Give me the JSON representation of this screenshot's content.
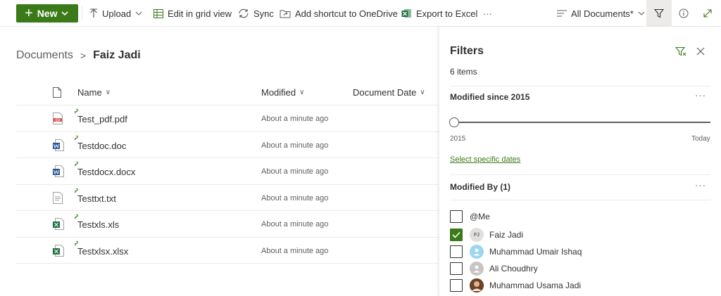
{
  "toolbar": {
    "new_label": "New",
    "upload_label": "Upload",
    "grid_label": "Edit in grid view",
    "sync_label": "Sync",
    "shortcut_label": "Add shortcut to OneDrive",
    "export_label": "Export to Excel",
    "more_label": "···",
    "view_label": "All Documents*"
  },
  "breadcrumb": {
    "root": "Documents",
    "current": "Faiz Jadi"
  },
  "list": {
    "columns": {
      "name": "Name",
      "modified": "Modified",
      "doc_date": "Document Date"
    },
    "rows": [
      {
        "name": "Test_pdf.pdf",
        "modified": "About a minute ago",
        "type": "pdf"
      },
      {
        "name": "Testdoc.doc",
        "modified": "About a minute ago",
        "type": "word"
      },
      {
        "name": "Testdocx.docx",
        "modified": "About a minute ago",
        "type": "word"
      },
      {
        "name": "Testtxt.txt",
        "modified": "About a minute ago",
        "type": "txt"
      },
      {
        "name": "Testxls.xls",
        "modified": "About a minute ago",
        "type": "excel"
      },
      {
        "name": "Testxlsx.xlsx",
        "modified": "About a minute ago",
        "type": "excel"
      }
    ]
  },
  "filters": {
    "title": "Filters",
    "count": "6 items",
    "modified_section": "Modified since 2015",
    "slider_start": "2015",
    "slider_end": "Today",
    "slider_value": 0,
    "select_dates": "Select specific dates",
    "modified_by_section": "Modified By (1)",
    "more": "···",
    "people": [
      {
        "name": "@Me",
        "checked": false,
        "avatar": "none"
      },
      {
        "name": "Faiz Jadi",
        "checked": true,
        "avatar": "initials",
        "initials": "FJ"
      },
      {
        "name": "Muhammad Umair Ishaq",
        "checked": false,
        "avatar": "blue-person"
      },
      {
        "name": "Ali Choudhry",
        "checked": false,
        "avatar": "grey-person"
      },
      {
        "name": "Muhammad Usama Jadi",
        "checked": false,
        "avatar": "photo"
      }
    ]
  },
  "colors": {
    "accent": "#3a7a18",
    "text": "#323130",
    "muted": "#605e5c",
    "border": "#edebe9"
  }
}
